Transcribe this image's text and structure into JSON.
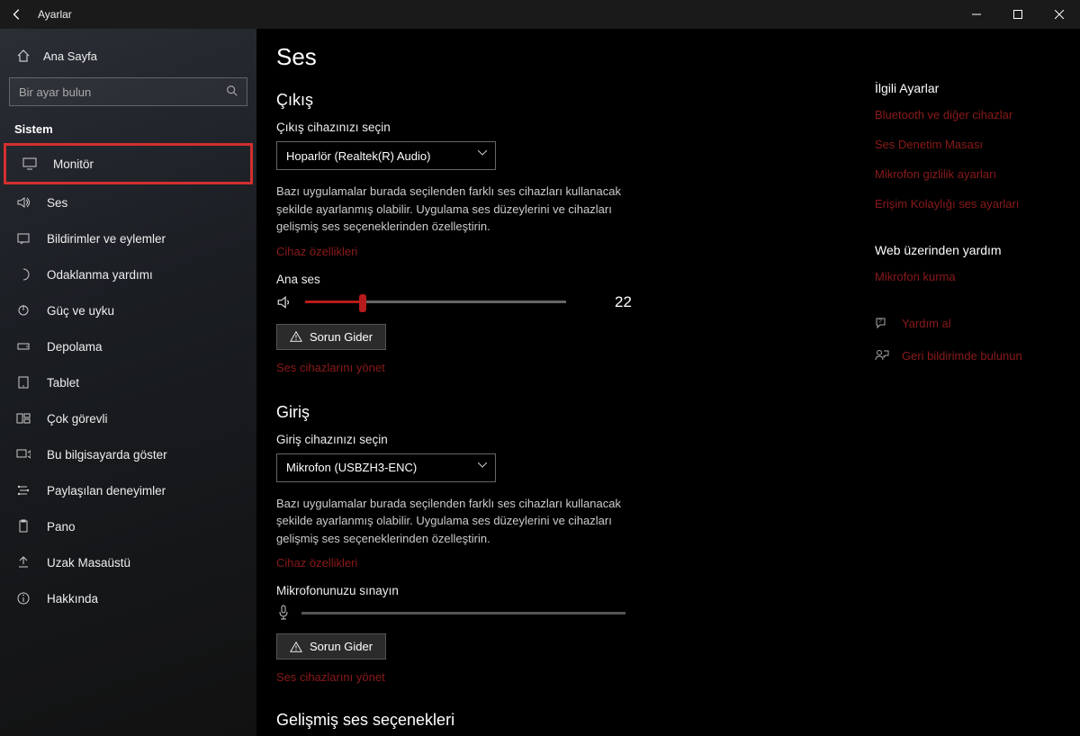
{
  "titlebar": {
    "title": "Ayarlar"
  },
  "sidebar": {
    "home": "Ana Sayfa",
    "search_placeholder": "Bir ayar bulun",
    "section": "Sistem",
    "items": [
      {
        "label": "Monitör",
        "icon": "monitor"
      },
      {
        "label": "Ses",
        "icon": "sound"
      },
      {
        "label": "Bildirimler ve eylemler",
        "icon": "notifications"
      },
      {
        "label": "Odaklanma yardımı",
        "icon": "focus"
      },
      {
        "label": "Güç ve uyku",
        "icon": "power"
      },
      {
        "label": "Depolama",
        "icon": "storage"
      },
      {
        "label": "Tablet",
        "icon": "tablet"
      },
      {
        "label": "Çok görevli",
        "icon": "multitask"
      },
      {
        "label": "Bu bilgisayarda göster",
        "icon": "project"
      },
      {
        "label": "Paylaşılan deneyimler",
        "icon": "shared"
      },
      {
        "label": "Pano",
        "icon": "clipboard"
      },
      {
        "label": "Uzak Masaüstü",
        "icon": "remote"
      },
      {
        "label": "Hakkında",
        "icon": "about"
      }
    ]
  },
  "main": {
    "title": "Ses",
    "output": {
      "heading": "Çıkış",
      "select_label": "Çıkış cihazınızı seçin",
      "selected": "Hoparlör (Realtek(R) Audio)",
      "desc": "Bazı uygulamalar burada seçilenden farklı ses cihazları kullanacak şekilde ayarlanmış olabilir. Uygulama ses düzeylerini ve cihazları gelişmiş ses seçeneklerinden özelleştirin.",
      "device_props": "Cihaz özellikleri",
      "master_label": "Ana ses",
      "volume": 22,
      "troubleshoot": "Sorun Gider",
      "manage": "Ses cihazlarını yönet"
    },
    "input": {
      "heading": "Giriş",
      "select_label": "Giriş cihazınızı seçin",
      "selected": "Mikrofon (USBZH3-ENC)",
      "desc": "Bazı uygulamalar burada seçilenden farklı ses cihazları kullanacak şekilde ayarlanmış olabilir. Uygulama ses düzeylerini ve cihazları gelişmiş ses seçeneklerinden özelleştirin.",
      "device_props": "Cihaz özellikleri",
      "test_label": "Mikrofonunuzu sınayın",
      "troubleshoot": "Sorun Gider",
      "manage": "Ses cihazlarını yönet"
    },
    "advanced_heading": "Gelişmiş ses seçenekleri"
  },
  "right": {
    "related_heading": "İlgili Ayarlar",
    "related": [
      "Bluetooth ve diğer cihazlar",
      "Ses Denetim Masası",
      "Mikrofon gizlilik ayarları",
      "Erişim Kolaylığı ses ayarları"
    ],
    "help_heading": "Web üzerinden yardım",
    "help_links": [
      "Mikrofon kurma"
    ],
    "actions": {
      "help": "Yardım al",
      "feedback": "Geri bildirimde bulunun"
    }
  }
}
